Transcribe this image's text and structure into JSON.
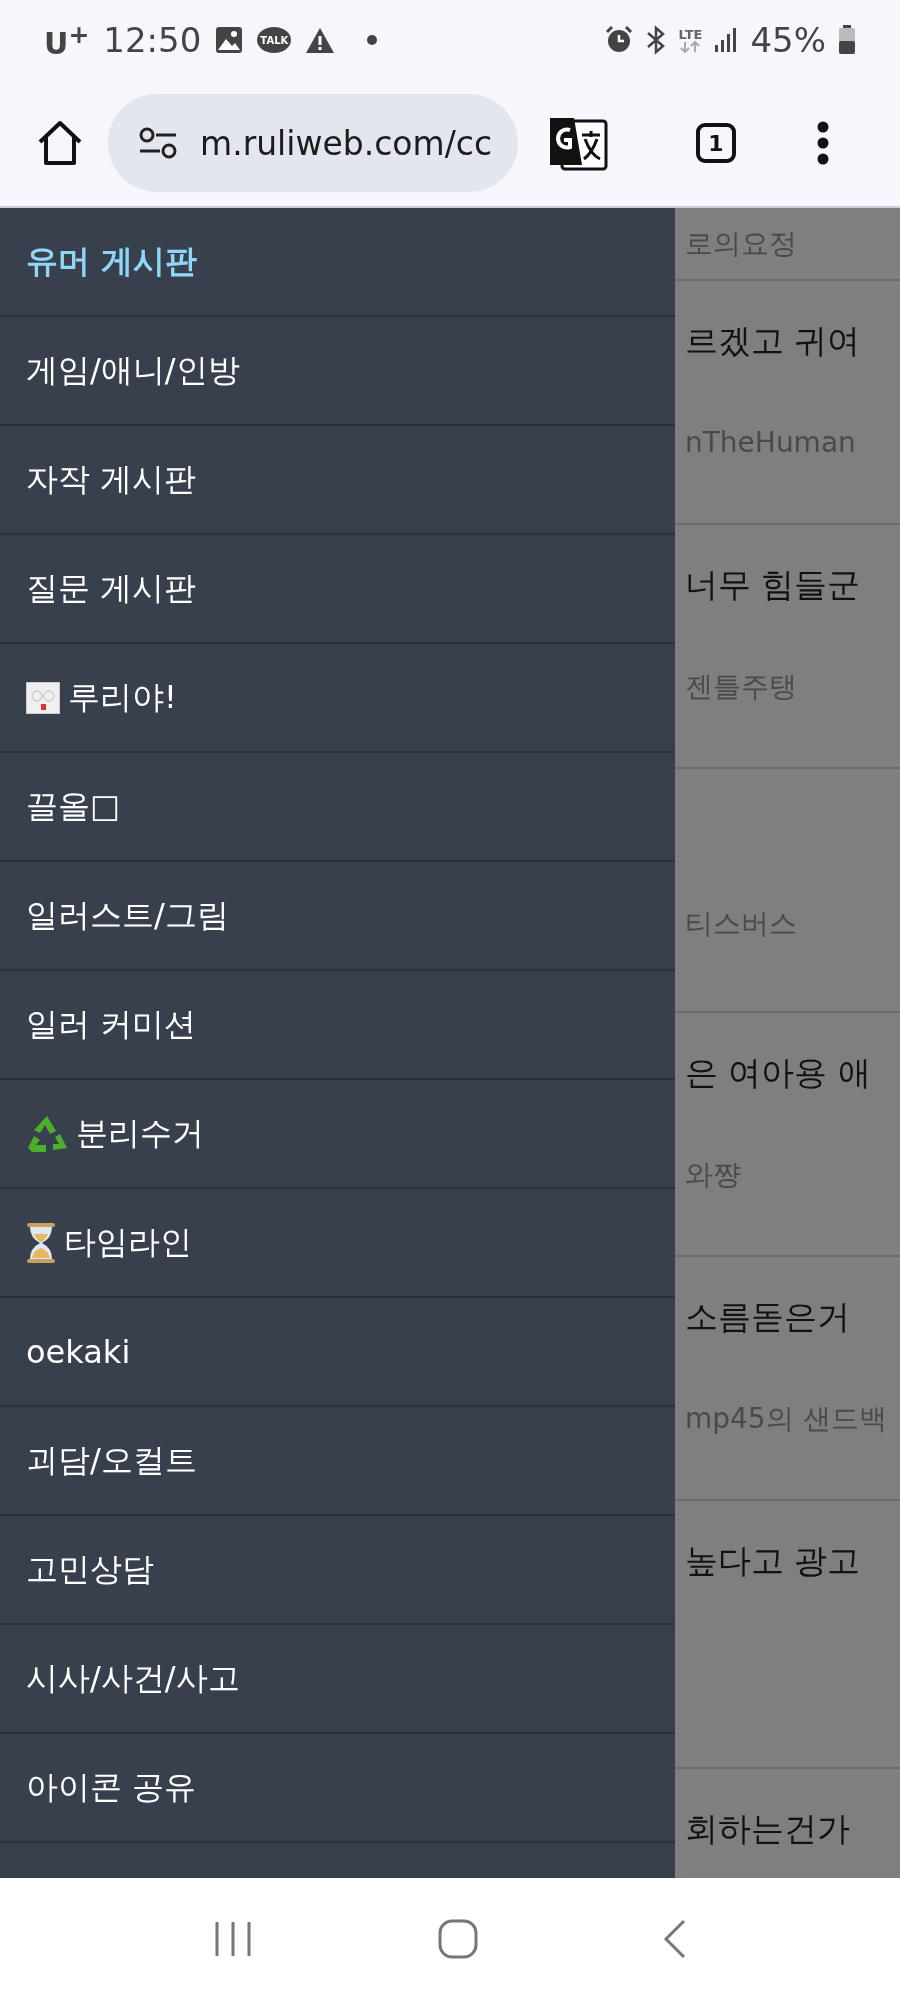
{
  "status_bar": {
    "carrier": "U$^{+}$",
    "time": "12:50",
    "notification": "TALK",
    "network": "LTE",
    "battery": "45%"
  },
  "browser": {
    "url": "m.ruliweb.com/cc",
    "tab_count": "1"
  },
  "drawer": {
    "items": [
      {
        "label": "유머 게시판",
        "selected": true
      },
      {
        "label": "게임/애니/인방",
        "selected": false
      },
      {
        "label": "자작 게시판",
        "selected": false
      },
      {
        "label": "질문 게시판",
        "selected": false
      },
      {
        "label": "루리야!",
        "selected": false,
        "kind": "image"
      },
      {
        "label": "끌올□",
        "selected": false
      },
      {
        "label": "일러스트/그림",
        "selected": false
      },
      {
        "label": "일러 커미션",
        "selected": false
      },
      {
        "label": "분리수거",
        "selected": false,
        "kind": "recycle"
      },
      {
        "label": "타임라인",
        "selected": false,
        "kind": "hourglass"
      },
      {
        "label": "oekaki",
        "selected": false
      },
      {
        "label": "괴담/오컬트",
        "selected": false
      },
      {
        "label": "고민상담",
        "selected": false
      },
      {
        "label": "시사/사건/사고",
        "selected": false
      },
      {
        "label": "아이콘 공유",
        "selected": false
      }
    ]
  },
  "background_posts": [
    {
      "author": "로의요정"
    },
    {
      "title": "르겠고 귀여",
      "author": "nTheHuman"
    },
    {
      "title": "너무 힘들군",
      "author": "젠틀주탱"
    },
    {
      "author": "티스버스"
    },
    {
      "title": "은 여아용 애",
      "author": "와쨩"
    },
    {
      "title": "소름돋은거",
      "author": "mp45의 샌드백"
    },
    {
      "title": "높다고 광고"
    },
    {
      "title": "회하는건가"
    }
  ]
}
